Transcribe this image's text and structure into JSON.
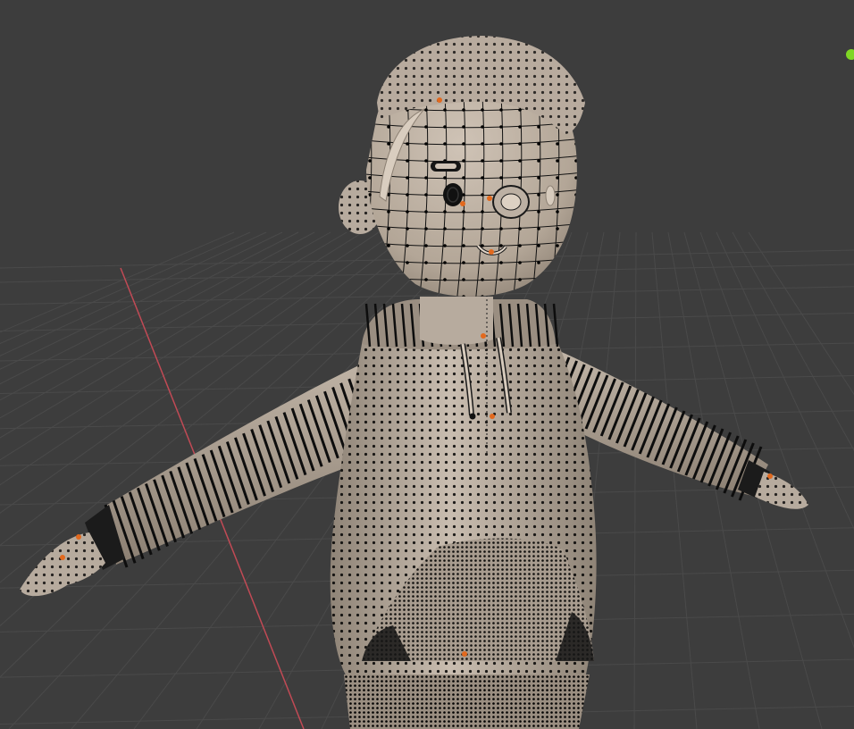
{
  "viewport": {
    "mode": "edit-mode-vertex-view",
    "background_color": "#3d3d3d",
    "grid_line_color": "#4a4a4a",
    "x_axis_color": "#c14a55",
    "origin_marker_color": "#7fd624",
    "mesh_color": "#b7ab9e",
    "mesh_shadow_color": "#8a7f72",
    "wire_color": "#111111",
    "vertex_color": "#000000",
    "selected_vertex_color": "#e2691e",
    "cuff_color": "#1b1b1b"
  },
  "model": {
    "name_icon": "character-hoodie-mesh",
    "parts": [
      "hair",
      "head",
      "ears",
      "eyes",
      "mouth",
      "hoodie",
      "hood",
      "drawstrings",
      "sleeves",
      "cuffs",
      "hands",
      "pocket",
      "pants"
    ]
  }
}
